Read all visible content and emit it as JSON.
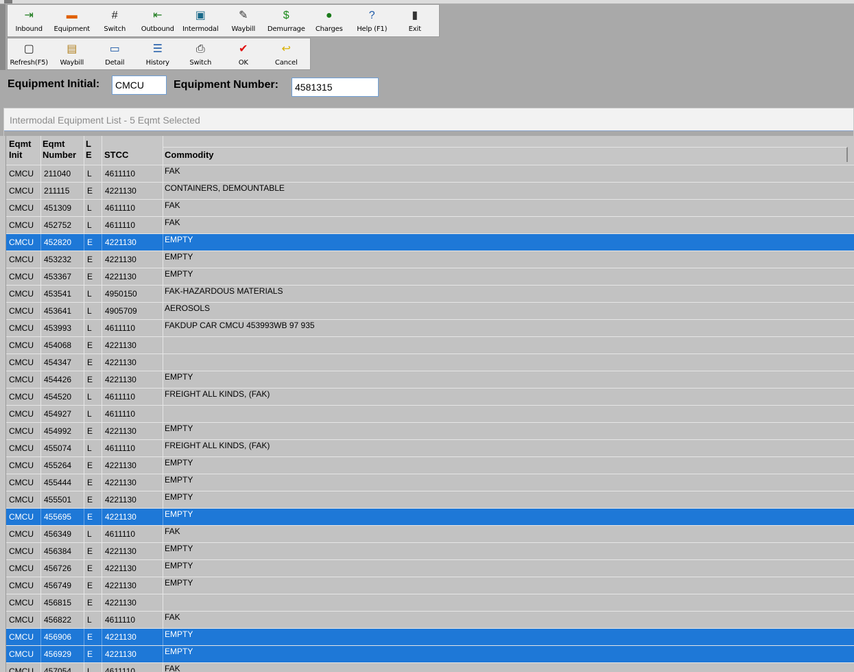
{
  "toolbar1": [
    {
      "label": "Inbound",
      "icon": "inbound-icon",
      "glyph": "⇥",
      "color": "#1a7a1a"
    },
    {
      "label": "Equipment",
      "icon": "equipment-icon",
      "glyph": "▬",
      "color": "#e06000"
    },
    {
      "label": "Switch",
      "icon": "switch-icon",
      "glyph": "#",
      "color": "#222222"
    },
    {
      "label": "Outbound",
      "icon": "outbound-icon",
      "glyph": "⇤",
      "color": "#1a7a1a"
    },
    {
      "label": "Intermodal",
      "icon": "intermodal-icon",
      "glyph": "▣",
      "color": "#1a6a8a"
    },
    {
      "label": "Waybill",
      "icon": "waybill-icon",
      "glyph": "✎",
      "color": "#333333"
    },
    {
      "label": "Demurrage",
      "icon": "dollar-icon",
      "glyph": "$",
      "color": "#1a8a1a"
    },
    {
      "label": "Charges",
      "icon": "money-bag-icon",
      "glyph": "●",
      "color": "#1a7a1a"
    },
    {
      "label": "Help (F1)",
      "icon": "help-icon",
      "glyph": "?",
      "color": "#1e5aa8"
    },
    {
      "label": "Exit",
      "icon": "exit-icon",
      "glyph": "▮",
      "color": "#333333"
    }
  ],
  "toolbar2": [
    {
      "label": "Refresh(F5)",
      "icon": "refresh-icon",
      "glyph": "▢",
      "color": "#222222"
    },
    {
      "label": "Waybill",
      "icon": "waybill-doc-icon",
      "glyph": "▤",
      "color": "#b08020"
    },
    {
      "label": "Detail",
      "icon": "detail-icon",
      "glyph": "▭",
      "color": "#1e5aa8"
    },
    {
      "label": "History",
      "icon": "history-icon",
      "glyph": "☰",
      "color": "#1e5aa8"
    },
    {
      "label": "Switch",
      "icon": "printer-icon",
      "glyph": "⎙",
      "color": "#222222"
    },
    {
      "label": "OK",
      "icon": "check-icon",
      "glyph": "✔",
      "color": "#e01010"
    },
    {
      "label": "Cancel",
      "icon": "cancel-icon",
      "glyph": "↩",
      "color": "#d8b000"
    }
  ],
  "filter": {
    "initial_label": "Equipment Initial:",
    "initial_value": "CMCU",
    "number_label": "Equipment Number:",
    "number_value": "4581315"
  },
  "list": {
    "title": "Intermodal Equipment List - 5 Eqmt Selected",
    "headers": {
      "init_top": "Eqmt",
      "init_bottom": "Init",
      "num_top": "Eqmt",
      "num_bottom": "Number",
      "le_top": "L",
      "le_bottom": "E",
      "stcc": "STCC",
      "commodity": "Commodity"
    },
    "rows": [
      {
        "init": "CMCU",
        "num": "211040",
        "le": "L",
        "stcc": "4611110",
        "commodity": "FAK",
        "selected": false
      },
      {
        "init": "CMCU",
        "num": "211115",
        "le": "E",
        "stcc": "4221130",
        "commodity": "CONTAINERS, DEMOUNTABLE",
        "selected": false
      },
      {
        "init": "CMCU",
        "num": "451309",
        "le": "L",
        "stcc": "4611110",
        "commodity": "FAK",
        "selected": false
      },
      {
        "init": "CMCU",
        "num": "452752",
        "le": "L",
        "stcc": "4611110",
        "commodity": "FAK",
        "selected": false
      },
      {
        "init": "CMCU",
        "num": "452820",
        "le": "E",
        "stcc": "4221130",
        "commodity": "EMPTY",
        "selected": true
      },
      {
        "init": "CMCU",
        "num": "453232",
        "le": "E",
        "stcc": "4221130",
        "commodity": "EMPTY",
        "selected": false
      },
      {
        "init": "CMCU",
        "num": "453367",
        "le": "E",
        "stcc": "4221130",
        "commodity": "EMPTY",
        "selected": false
      },
      {
        "init": "CMCU",
        "num": "453541",
        "le": "L",
        "stcc": "4950150",
        "commodity": "FAK-HAZARDOUS MATERIALS",
        "selected": false
      },
      {
        "init": "CMCU",
        "num": "453641",
        "le": "L",
        "stcc": "4905709",
        "commodity": "AEROSOLS",
        "selected": false
      },
      {
        "init": "CMCU",
        "num": "453993",
        "le": "L",
        "stcc": "4611110",
        "commodity": "FAKDUP CAR CMCU    453993WB 97 935",
        "selected": false
      },
      {
        "init": "CMCU",
        "num": "454068",
        "le": "E",
        "stcc": "4221130",
        "commodity": "",
        "selected": false
      },
      {
        "init": "CMCU",
        "num": "454347",
        "le": "E",
        "stcc": "4221130",
        "commodity": "",
        "selected": false
      },
      {
        "init": "CMCU",
        "num": "454426",
        "le": "E",
        "stcc": "4221130",
        "commodity": "EMPTY",
        "selected": false
      },
      {
        "init": "CMCU",
        "num": "454520",
        "le": "L",
        "stcc": "4611110",
        "commodity": "FREIGHT ALL KINDS, (FAK)",
        "selected": false
      },
      {
        "init": "CMCU",
        "num": "454927",
        "le": "L",
        "stcc": "4611110",
        "commodity": "",
        "selected": false
      },
      {
        "init": "CMCU",
        "num": "454992",
        "le": "E",
        "stcc": "4221130",
        "commodity": "EMPTY",
        "selected": false
      },
      {
        "init": "CMCU",
        "num": "455074",
        "le": "L",
        "stcc": "4611110",
        "commodity": "FREIGHT ALL KINDS, (FAK)",
        "selected": false
      },
      {
        "init": "CMCU",
        "num": "455264",
        "le": "E",
        "stcc": "4221130",
        "commodity": "EMPTY",
        "selected": false
      },
      {
        "init": "CMCU",
        "num": "455444",
        "le": "E",
        "stcc": "4221130",
        "commodity": "EMPTY",
        "selected": false
      },
      {
        "init": "CMCU",
        "num": "455501",
        "le": "E",
        "stcc": "4221130",
        "commodity": "EMPTY",
        "selected": false
      },
      {
        "init": "CMCU",
        "num": "455695",
        "le": "E",
        "stcc": "4221130",
        "commodity": "EMPTY",
        "selected": true
      },
      {
        "init": "CMCU",
        "num": "456349",
        "le": "L",
        "stcc": "4611110",
        "commodity": "FAK",
        "selected": false
      },
      {
        "init": "CMCU",
        "num": "456384",
        "le": "E",
        "stcc": "4221130",
        "commodity": "EMPTY",
        "selected": false
      },
      {
        "init": "CMCU",
        "num": "456726",
        "le": "E",
        "stcc": "4221130",
        "commodity": "EMPTY",
        "selected": false
      },
      {
        "init": "CMCU",
        "num": "456749",
        "le": "E",
        "stcc": "4221130",
        "commodity": "EMPTY",
        "selected": false
      },
      {
        "init": "CMCU",
        "num": "456815",
        "le": "E",
        "stcc": "4221130",
        "commodity": "",
        "selected": false
      },
      {
        "init": "CMCU",
        "num": "456822",
        "le": "L",
        "stcc": "4611110",
        "commodity": "FAK",
        "selected": false
      },
      {
        "init": "CMCU",
        "num": "456906",
        "le": "E",
        "stcc": "4221130",
        "commodity": "EMPTY",
        "selected": true
      },
      {
        "init": "CMCU",
        "num": "456929",
        "le": "E",
        "stcc": "4221130",
        "commodity": "EMPTY",
        "selected": true
      },
      {
        "init": "CMCU",
        "num": "457054",
        "le": "L",
        "stcc": "4611110",
        "commodity": "FAK",
        "selected": false
      }
    ]
  }
}
